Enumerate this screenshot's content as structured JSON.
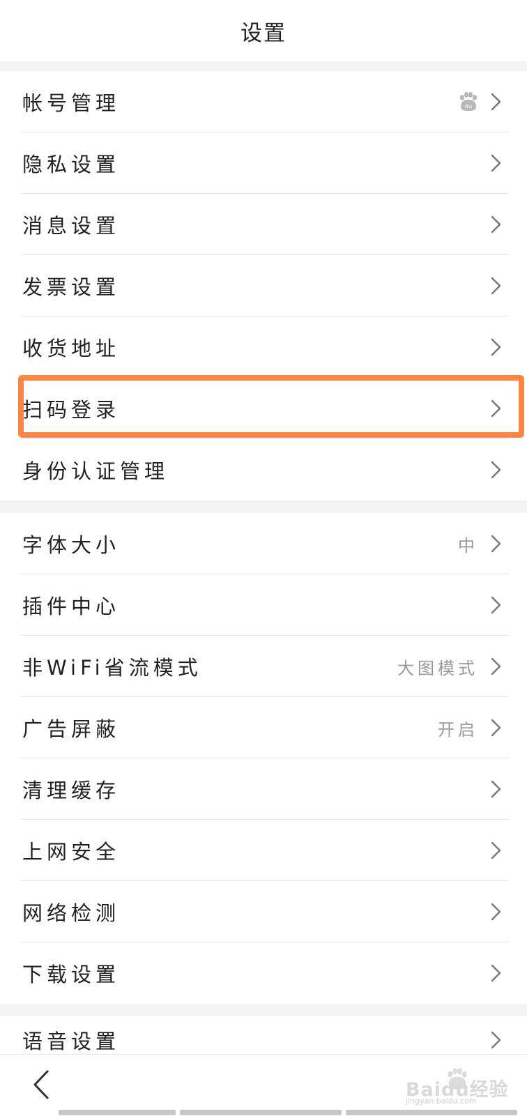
{
  "header": {
    "title": "设置"
  },
  "groups": [
    {
      "items": [
        {
          "label": "帐号管理",
          "value": ""
        },
        {
          "label": "隐私设置",
          "value": ""
        },
        {
          "label": "消息设置",
          "value": ""
        },
        {
          "label": "发票设置",
          "value": ""
        },
        {
          "label": "收货地址",
          "value": ""
        },
        {
          "label": "扫码登录",
          "value": ""
        },
        {
          "label": "身份认证管理",
          "value": ""
        }
      ]
    },
    {
      "items": [
        {
          "label": "字体大小",
          "value": "中"
        },
        {
          "label": "插件中心",
          "value": ""
        },
        {
          "label": "非WiFi省流模式",
          "value": "大图模式"
        },
        {
          "label": "广告屏蔽",
          "value": "开启"
        },
        {
          "label": "清理缓存",
          "value": ""
        },
        {
          "label": "上网安全",
          "value": ""
        },
        {
          "label": "网络检测",
          "value": ""
        },
        {
          "label": "下载设置",
          "value": ""
        }
      ]
    },
    {
      "items": [
        {
          "label": "语音设置",
          "value": ""
        }
      ]
    }
  ],
  "watermark": {
    "text": "Baidu经验",
    "sub": "jingyan.baidu.com"
  },
  "colors": {
    "highlight": "#ff8544",
    "background": "#f3f3f3",
    "icon": "#777777"
  },
  "icons": {
    "row_chevron": "chevron-right-icon",
    "account_badge": "baidu-paw-icon",
    "back": "back-arrow-icon"
  }
}
